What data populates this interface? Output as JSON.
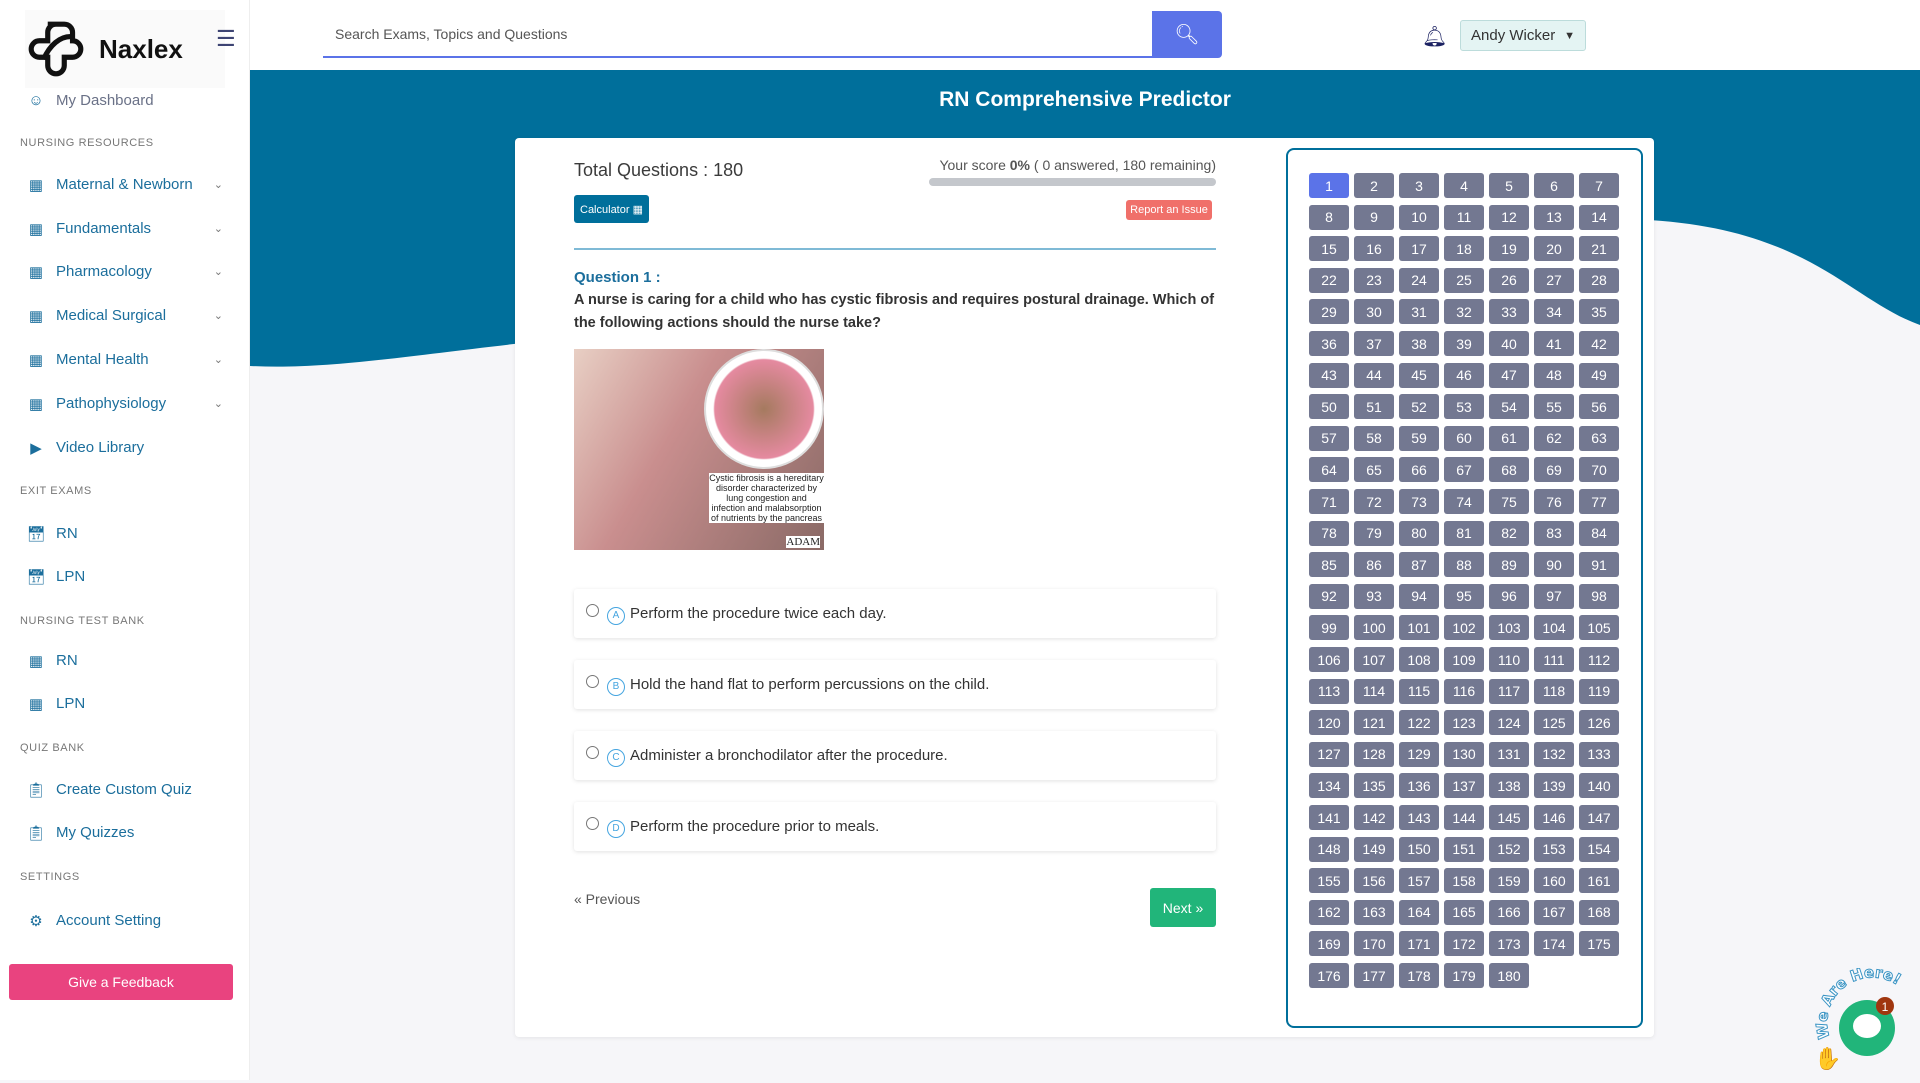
{
  "brand": {
    "name": "Naxlex"
  },
  "sidebar": {
    "dashboard": "My Dashboard",
    "sections": [
      {
        "title": "NURSING RESOURCES",
        "items": [
          "Maternal & Newborn",
          "Fundamentals",
          "Pharmacology",
          "Medical Surgical",
          "Mental Health",
          "Pathophysiology",
          "Video Library"
        ]
      },
      {
        "title": "EXIT EXAMS",
        "items": [
          "RN",
          "LPN"
        ]
      },
      {
        "title": "NURSING TEST BANK",
        "items": [
          "RN",
          "LPN"
        ]
      },
      {
        "title": "QUIZ BANK",
        "items": [
          "Create Custom Quiz",
          "My Quizzes"
        ]
      },
      {
        "title": "SETTINGS",
        "items": [
          "Account Setting"
        ]
      }
    ],
    "feedback": "Give a Feedback"
  },
  "header": {
    "search_placeholder": "Search Exams, Topics and Questions",
    "user": "Andy Wicker"
  },
  "page": {
    "title": "RN Comprehensive Predictor"
  },
  "quiz": {
    "total_label": "Total Questions : 180",
    "score_prefix": "Your score ",
    "score": "0%",
    "score_suffix": " ( 0 answered, 180 remaining)",
    "progress_percent": 0,
    "calculator": "Calculator",
    "report": "Report an Issue",
    "question_label": "Question 1 :",
    "question_text": "A nurse is caring for a child who has cystic fibrosis and requires postural drainage. Which of the following actions should the nurse take?",
    "image_caption": "Cystic fibrosis is a hereditary disorder characterized by lung congestion and infection and malabsorption of nutrients by the pancreas",
    "image_credit": "ADAM",
    "options": [
      {
        "letter": "A",
        "text": "Perform the procedure twice each day."
      },
      {
        "letter": "B",
        "text": "Hold the hand flat to perform percussions on the child."
      },
      {
        "letter": "C",
        "text": "Administer a bronchodilator after the procedure."
      },
      {
        "letter": "D",
        "text": "Perform the procedure prior to meals."
      }
    ],
    "previous": "« Previous",
    "next": "Next »"
  },
  "question_grid": {
    "total": 180,
    "current": 1
  },
  "chat": {
    "label": "We Are Here!",
    "badge": "1"
  },
  "colors": {
    "primary": "#006f9b",
    "accent": "#5b73e8",
    "grid": "#737891",
    "next": "#21b57a",
    "report": "#f0706a",
    "feedback": "#e9437f"
  }
}
